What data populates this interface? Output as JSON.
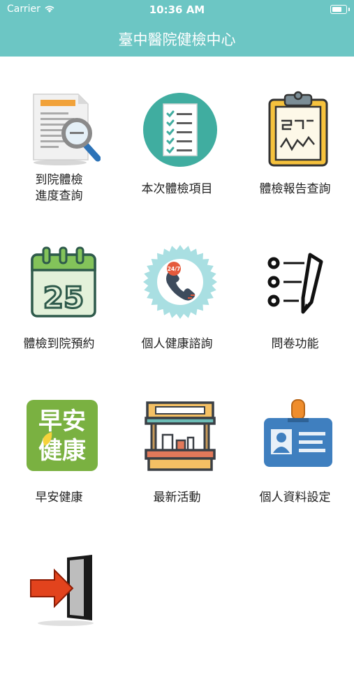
{
  "status_bar": {
    "carrier": "Carrier",
    "time": "10:36 AM"
  },
  "header": {
    "title": "臺中醫院健檢中心"
  },
  "menu": {
    "progress": {
      "line1": "到院體檢",
      "line2": "進度查詢"
    },
    "items_label": "本次體檢項目",
    "report": "體檢報告查詢",
    "appointment": "體檢到院預約",
    "consult": "個人健康諮詢",
    "questionnaire": "問卷功能",
    "morning_health": "早安健康",
    "morning_health_logo_line1": "早安",
    "morning_health_logo_line2": "健康",
    "news": "最新活動",
    "profile": "個人資料設定",
    "calendar_day": "25",
    "consult_badge": "24/7"
  },
  "colors": {
    "header": "#6cc6c4"
  }
}
